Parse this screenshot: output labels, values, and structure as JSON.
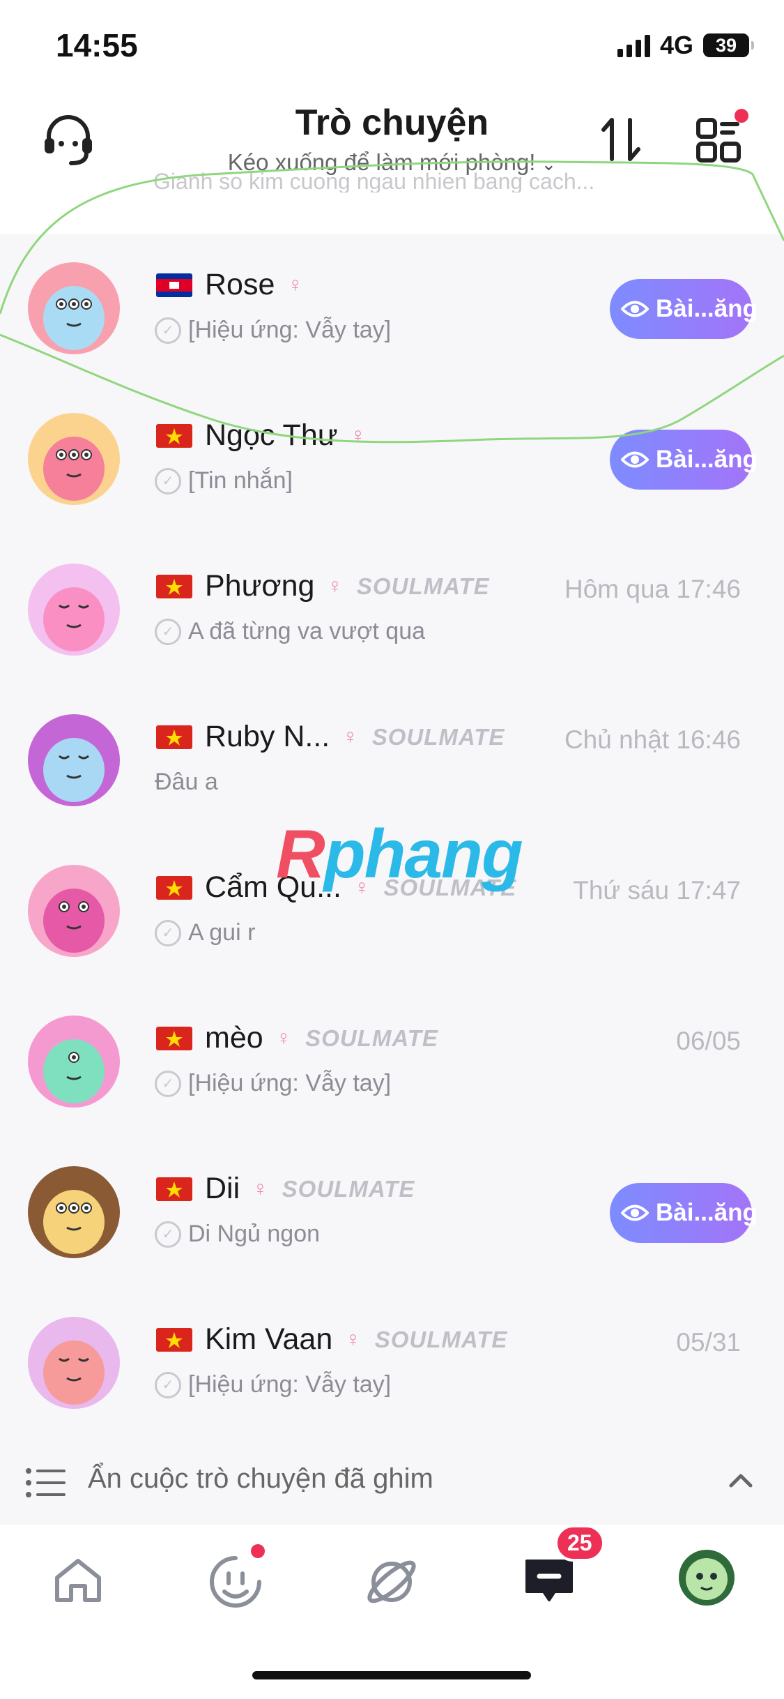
{
  "status_bar": {
    "time": "14:55",
    "network": "4G",
    "battery": "39"
  },
  "header": {
    "title": "Trò chuyện",
    "subtitle": "Kéo xuống để làm mới phòng!",
    "ghost_text": "Gianh so kim cuong ngau nhien bang cach..."
  },
  "colors": {
    "accent": "#8a7df9",
    "badge": "#ee3057",
    "soulmate_pink": "#ec5fb0"
  },
  "chats": [
    {
      "name": "Rose",
      "flag": "cambodia",
      "female": "♀",
      "soulmate": "",
      "time": "",
      "preview": "[Hiệu ứng: Vẫy tay]",
      "button": "Bài...ăng"
    },
    {
      "name": "Ngọc Thư",
      "flag": "vietnam",
      "female": "♀",
      "soulmate": "",
      "time": "",
      "preview": "[Tin nhắn]",
      "button": "Bài...ăng"
    },
    {
      "name": "Phương",
      "flag": "vietnam",
      "female": "♀",
      "soulmate": "SOULMATE",
      "time": "Hôm qua 17:46",
      "preview": "A đã từng va vượt qua",
      "button": ""
    },
    {
      "name": "Ruby N...",
      "flag": "vietnam",
      "female": "♀",
      "soulmate": "SOULMATE",
      "time": "Chủ nhật 16:46",
      "preview": "Đâu a",
      "button": ""
    },
    {
      "name": "Cẩm Qu...",
      "flag": "vietnam",
      "female": "♀",
      "soulmate": "SOULMATE",
      "time": "Thứ sáu 17:47",
      "preview": "A gui r",
      "button": ""
    },
    {
      "name": "mèo",
      "flag": "vietnam",
      "female": "♀",
      "soulmate": "SOULMATE",
      "time": "06/05",
      "preview": "[Hiệu ứng: Vẫy tay]",
      "button": ""
    },
    {
      "name": "Dii",
      "flag": "vietnam",
      "female": "♀",
      "soulmate": "SOULMATE",
      "time": "",
      "preview": "Di Ngủ ngon",
      "button": "Bài...ăng"
    },
    {
      "name": "Kim Vaan",
      "flag": "vietnam",
      "female": "♀",
      "soulmate": "SOULMATE",
      "time": "05/31",
      "preview": "[Hiệu ứng: Vẫy tay]",
      "button": ""
    }
  ],
  "pinned_bar": {
    "label": "Ẩn cuộc trò chuyện đã ghim"
  },
  "watermark": {
    "part1": "R",
    "part2": "phang"
  },
  "tabbar": {
    "items": [
      {
        "name": "home",
        "icon": "home-icon"
      },
      {
        "name": "match",
        "icon": "smiley-icon"
      },
      {
        "name": "planet",
        "icon": "planet-icon"
      },
      {
        "name": "chat",
        "icon": "chat-icon",
        "badge": "25"
      },
      {
        "name": "profile",
        "icon": "avatar-icon"
      }
    ]
  }
}
